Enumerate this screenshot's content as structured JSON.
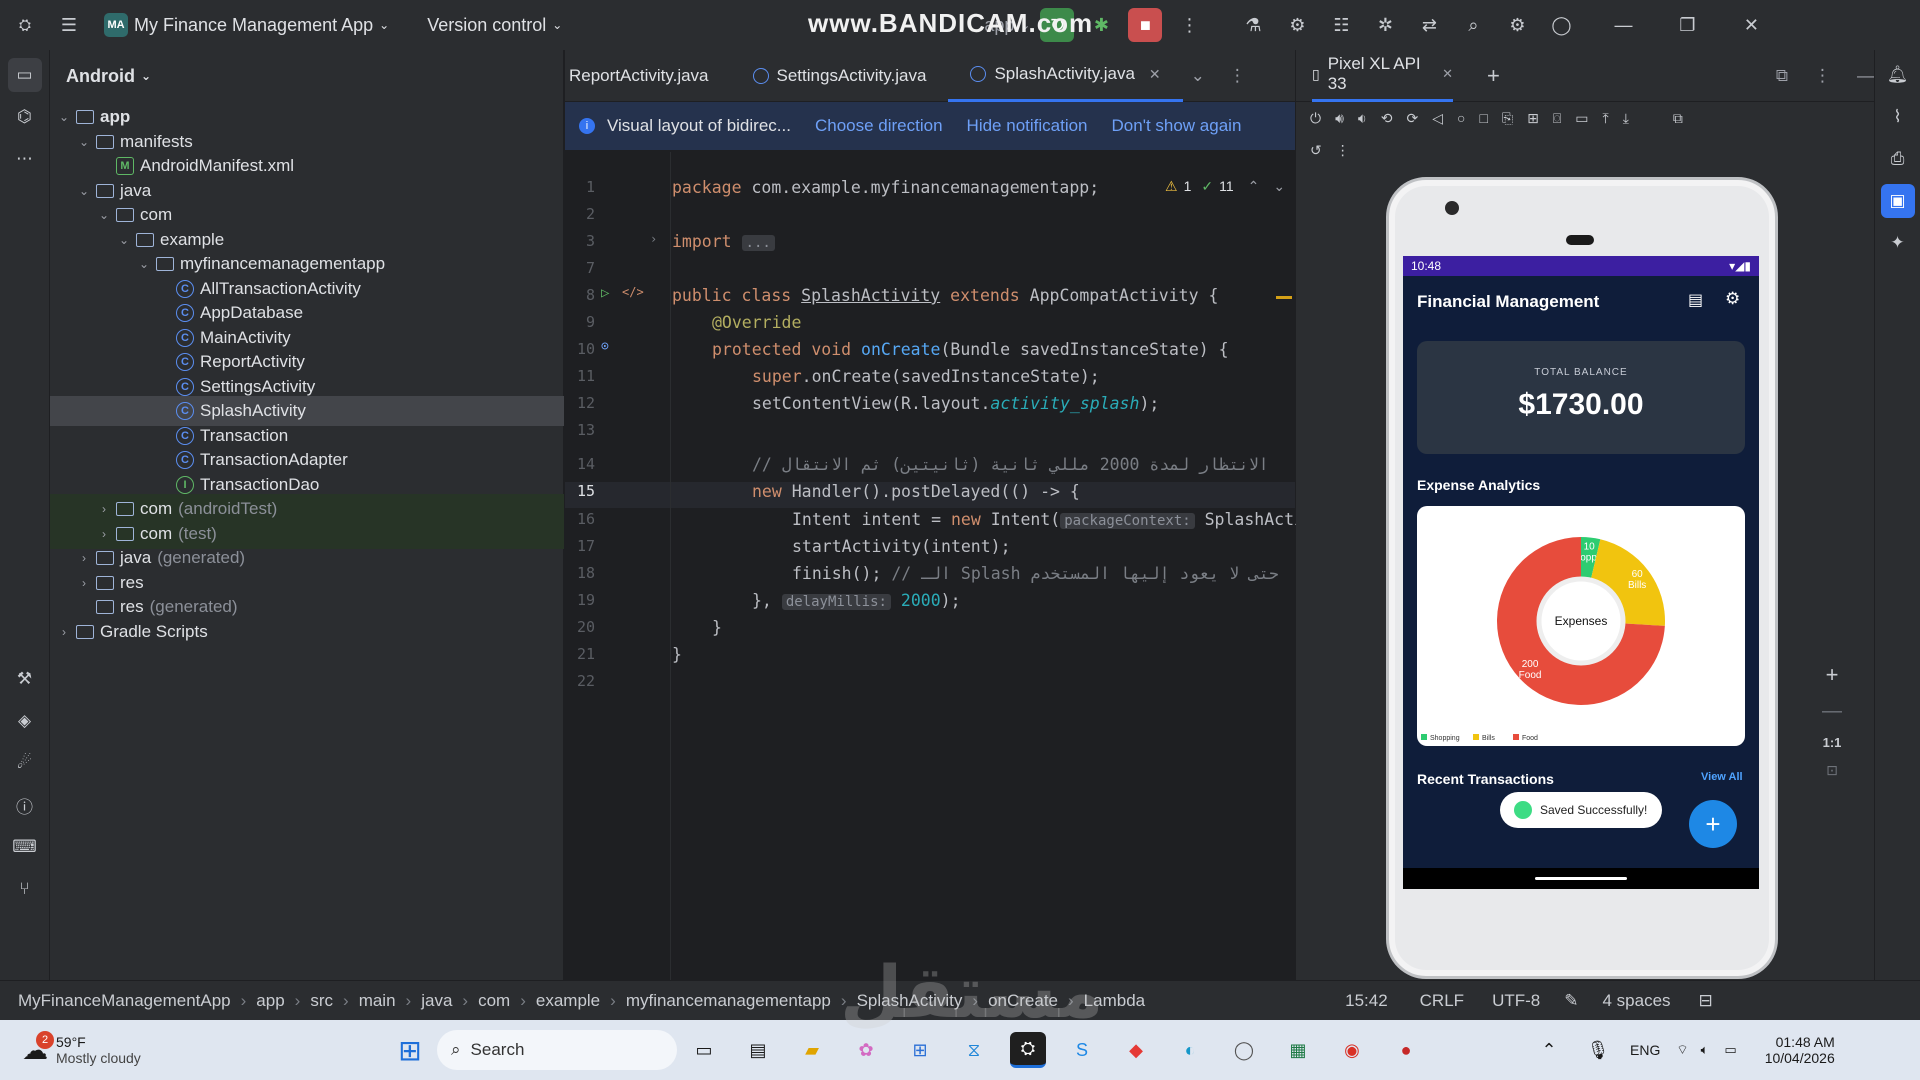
{
  "titlebar": {
    "project_badge": "MA",
    "project_name": "My Finance Management App",
    "vcs": "Version control",
    "run_config": "app",
    "watermark": "www.BANDICAM.com"
  },
  "project_panel": {
    "view_mode": "Android",
    "tree": [
      {
        "label": "app",
        "type": "module",
        "depth": 0,
        "expanded": true
      },
      {
        "label": "manifests",
        "type": "folder",
        "depth": 1,
        "expanded": true
      },
      {
        "label": "AndroidManifest.xml",
        "type": "xml",
        "depth": 2
      },
      {
        "label": "java",
        "type": "folder",
        "depth": 1,
        "expanded": true
      },
      {
        "label": "com",
        "type": "package",
        "depth": 2,
        "expanded": true
      },
      {
        "label": "example",
        "type": "package",
        "depth": 3,
        "expanded": true
      },
      {
        "label": "myfinancemanagementapp",
        "type": "package",
        "depth": 4,
        "expanded": true
      },
      {
        "label": "AllTransactionActivity",
        "type": "class",
        "depth": 5
      },
      {
        "label": "AppDatabase",
        "type": "class",
        "depth": 5
      },
      {
        "label": "MainActivity",
        "type": "class",
        "depth": 5
      },
      {
        "label": "ReportActivity",
        "type": "class",
        "depth": 5
      },
      {
        "label": "SettingsActivity",
        "type": "class",
        "depth": 5
      },
      {
        "label": "SplashActivity",
        "type": "class",
        "depth": 5,
        "selected": true
      },
      {
        "label": "Transaction",
        "type": "class",
        "depth": 5
      },
      {
        "label": "TransactionAdapter",
        "type": "class",
        "depth": 5
      },
      {
        "label": "TransactionDao",
        "type": "interface",
        "depth": 5
      },
      {
        "label": "com",
        "suffix": "(androidTest)",
        "type": "package",
        "depth": 2,
        "collapsed": true
      },
      {
        "label": "com",
        "suffix": "(test)",
        "type": "package",
        "depth": 2,
        "collapsed": true
      },
      {
        "label": "java",
        "suffix": "(generated)",
        "type": "folder",
        "depth": 1,
        "collapsed": true
      },
      {
        "label": "res",
        "type": "folder",
        "depth": 1,
        "collapsed": true
      },
      {
        "label": "res",
        "suffix": "(generated)",
        "type": "folder",
        "depth": 1
      },
      {
        "label": "Gradle Scripts",
        "type": "gradle",
        "depth": 0,
        "collapsed": true
      }
    ]
  },
  "editor": {
    "tabs": [
      "ReportActivity.java",
      "SettingsActivity.java",
      "SplashActivity.java"
    ],
    "active_tab": "SplashActivity.java",
    "notification": {
      "text": "Visual layout of bidirec...",
      "actions": [
        "Choose direction",
        "Hide notification",
        "Don't show again"
      ]
    },
    "inspections": {
      "warnings": "1",
      "ok": "11"
    },
    "line_numbers": [
      "1",
      "2",
      "3",
      "7",
      "8",
      "9",
      "10",
      "11",
      "12",
      "13",
      "14",
      "15",
      "16",
      "17",
      "18",
      "19",
      "20",
      "21",
      "22"
    ],
    "code": {
      "l1_kw": "package",
      "l1": " com.example.myfinancemanagementapp;",
      "l3_kw": "import",
      "l3_fold": "...",
      "l8_kw": "public class",
      "l8_name": "SplashActivity",
      "l8_ext": "extends",
      "l8_rest": " AppCompatActivity {",
      "l9": "@Override",
      "l10_kw": "protected void",
      "l10_fn": "onCreate",
      "l10_rest": "(Bundle savedInstanceState) {",
      "l11_kw": "super",
      "l11_rest": ".onCreate(savedInstanceState);",
      "l12_a": "setContentView(R.layout.",
      "l12_it": "activity_splash",
      "l12_b": ");",
      "l14": "// الانتظار لمدة 2000 مللي ثانية (ثانيتين) ثم الانتقال",
      "l15_kw": "new",
      "l15_rest": " Handler().postDelayed(() -> {",
      "l16_a": "Intent intent = ",
      "l16_kw": "new",
      "l16_b": " Intent(",
      "l16_hint": "packageContext:",
      "l16_c": " SplashActi",
      "l17": "startActivity(intent);",
      "l18_a": "finish(); ",
      "l18_cm": "// الـ Splash حتى لا يعود إليها المستخدم",
      "l19_a": "}, ",
      "l19_hint": "delayMillis:",
      "l19_num": " 2000",
      "l19_b": ");",
      "l20": "}",
      "l21": "}"
    }
  },
  "device_panel": {
    "device_tab": "Pixel XL API 33",
    "zoom_label": "1:1",
    "phone": {
      "time": "10:48",
      "app_title": "Financial Management",
      "balance_label": "TOTAL BALANCE",
      "balance_value": "$1730.00",
      "analytics_title": "Expense Analytics",
      "chart_center": "Expenses",
      "recent_title": "Recent Transactions",
      "view_all": "View All",
      "toast": "Saved Successfully!",
      "fab": "+"
    }
  },
  "chart_data": {
    "type": "pie",
    "center_label": "Expenses",
    "categories": [
      "Shopping",
      "Bills",
      "Food"
    ],
    "values": [
      10,
      60,
      200
    ],
    "colors": [
      "#2ecc71",
      "#f1c40f",
      "#e74c3c"
    ],
    "legend": [
      "Shopping",
      "Bills",
      "Food"
    ],
    "legend_position": "bottom-left"
  },
  "breadcrumb": {
    "items": [
      "MyFinanceManagementApp",
      "app",
      "src",
      "main",
      "java",
      "com",
      "example",
      "myfinancemanagementapp",
      "SplashActivity",
      "onCreate",
      "Lambda"
    ],
    "position": "15:42",
    "line_sep": "CRLF",
    "encoding": "UTF-8",
    "indent": "4 spaces"
  },
  "taskbar": {
    "weather_temp": "59°F",
    "weather_desc": "Mostly cloudy",
    "weather_badge": "2",
    "search": "Search",
    "lang": "ENG",
    "time": "01:48 AM",
    "date": "10/04/2026"
  },
  "watermark_bottom": "مستقل"
}
